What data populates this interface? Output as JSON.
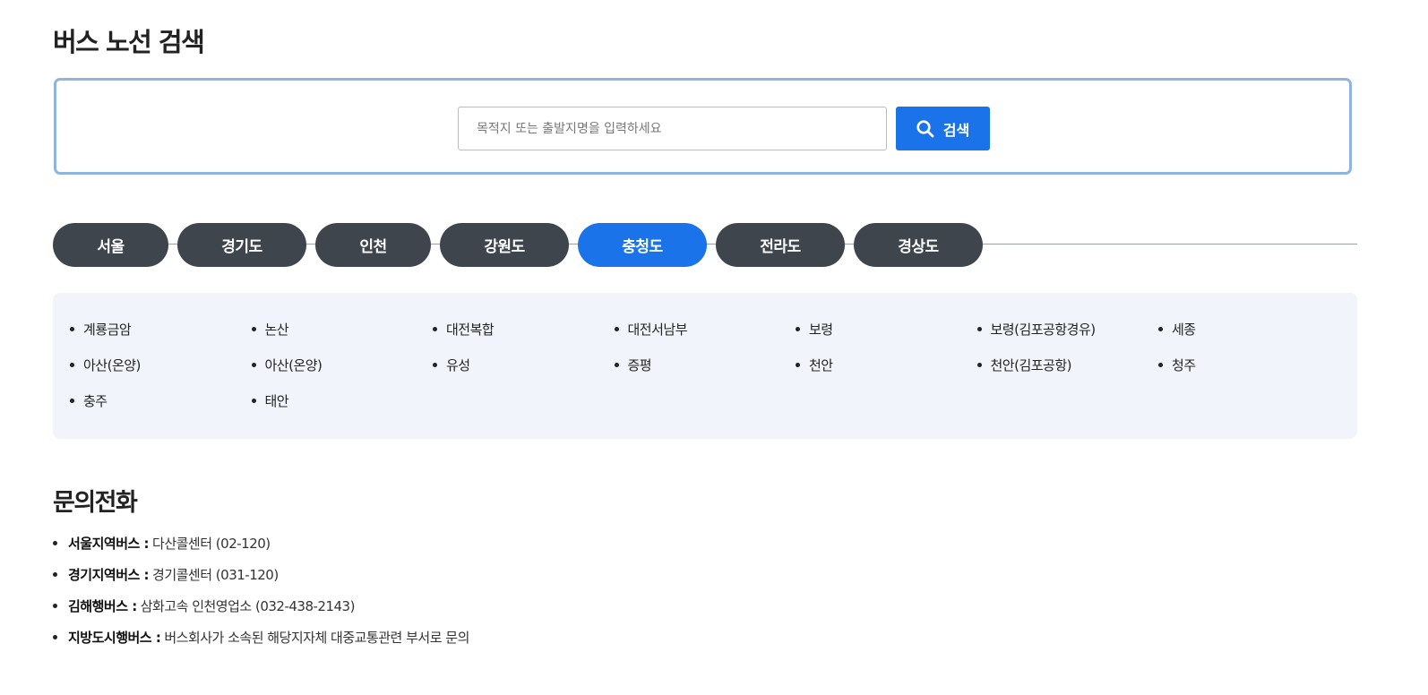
{
  "page": {
    "title": "버스 노선 검색"
  },
  "search": {
    "placeholder": "목적지 또는 출발지명을 입력하세요",
    "button_label": "검색",
    "icon": "search-icon"
  },
  "tabs": [
    {
      "label": "서울",
      "active": false
    },
    {
      "label": "경기도",
      "active": false
    },
    {
      "label": "인천",
      "active": false
    },
    {
      "label": "강원도",
      "active": false
    },
    {
      "label": "충청도",
      "active": true
    },
    {
      "label": "전라도",
      "active": false
    },
    {
      "label": "경상도",
      "active": false
    }
  ],
  "regions": [
    "계룡금암",
    "논산",
    "대전복합",
    "대전서남부",
    "보령",
    "보령(김포공항경유)",
    "세종",
    "아산(온양)",
    "아산(온양)",
    "유성",
    "증평",
    "천안",
    "천안(김포공항)",
    "청주",
    "충주",
    "태안"
  ],
  "inquiry": {
    "title": "문의전화",
    "items": [
      {
        "label": "서울지역버스 :",
        "value": "다산콜센터 (02-120)"
      },
      {
        "label": "경기지역버스 :",
        "value": "경기콜센터 (031-120)"
      },
      {
        "label": "김해행버스 :",
        "value": "삼화고속 인천영업소 (032-438-2143)"
      },
      {
        "label": "지방도시행버스 :",
        "value": "버스회사가 소속된 해당지자체 대중교통관련 부서로 문의"
      }
    ]
  },
  "colors": {
    "accent": "#1a73e8",
    "tab_inactive": "#3f454d",
    "search_border": "#8fb4df",
    "panel_bg": "#f1f5fb"
  }
}
